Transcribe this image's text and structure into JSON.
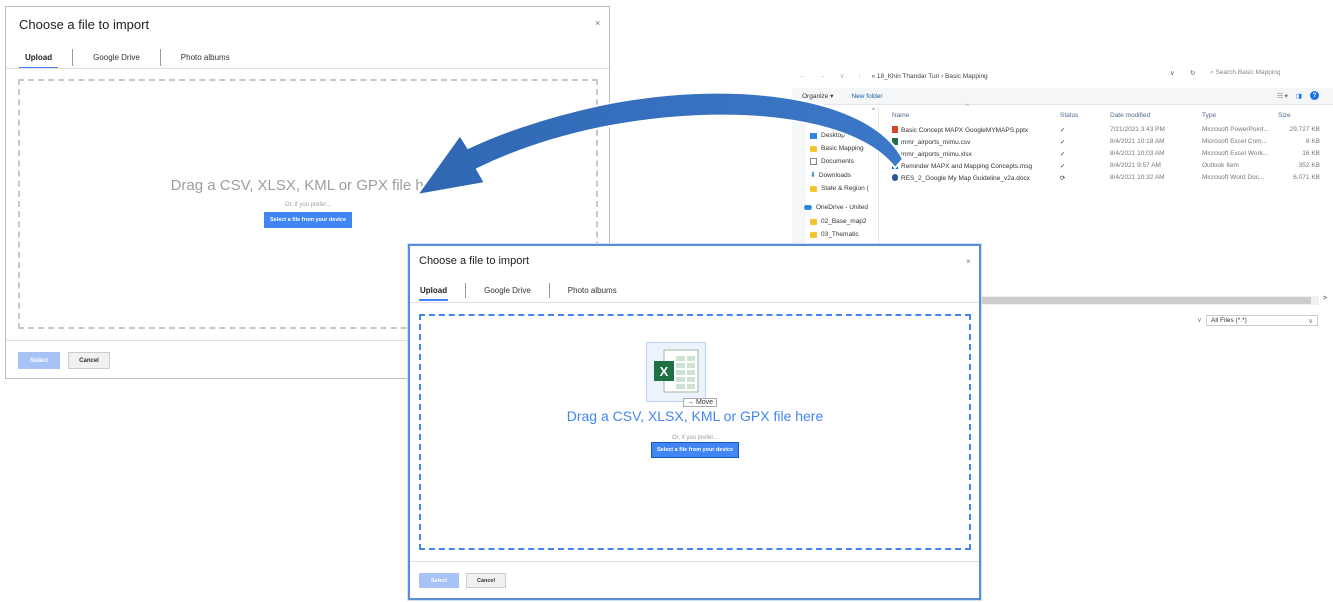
{
  "back_dialog": {
    "title": "Choose a file to import",
    "close": "×",
    "tabs": [
      "Upload",
      "Google Drive",
      "Photo albums"
    ],
    "drag_text": "Drag a CSV, XLSX, KML or GPX file here",
    "or_text": "Or, if you prefer...",
    "device_button": "Select a file from your device",
    "select_button": "Select",
    "cancel_button": "Cancel"
  },
  "explorer": {
    "nav_arrows": "← → ∨ ↑",
    "breadcrumb": "« 18_Khin Thandar Tun › Basic Mapping",
    "address_dropdown": "∨",
    "refresh": "↻",
    "search_placeholder": "⌕  Search Basic Mapping",
    "organize": "Organize ▾",
    "new_folder": "New folder",
    "view_icon": "☷ ▾",
    "pane_icon": "◨",
    "help": "?",
    "nav_scroll_up": "^",
    "nav_items": [
      {
        "label": "Desktop",
        "icon": "desktop-icon"
      },
      {
        "label": "Basic Mapping",
        "icon": "folder-icon"
      },
      {
        "label": "Documents",
        "icon": "documents-icon"
      },
      {
        "label": "Downloads",
        "icon": "downloads-icon"
      },
      {
        "label": "State & Region (",
        "icon": "folder-icon"
      },
      {
        "label": "OneDrive - United",
        "icon": "onedrive-icon"
      },
      {
        "label": "02_Base_map2",
        "icon": "folder-icon"
      },
      {
        "label": "03_Thematic",
        "icon": "folder-icon"
      }
    ],
    "columns": {
      "name": "Name",
      "status": "Status",
      "date": "Date modified",
      "type": "Type",
      "size": "Size",
      "sort": "^"
    },
    "files": [
      {
        "name": "Basic Concept MAPX GoogleMYMAPS.pptx",
        "kind": "pptx",
        "status": "✓",
        "date": "7/21/2021 3:43 PM",
        "type": "Microsoft PowerPoint...",
        "size": "29,727 KB"
      },
      {
        "name": "mmr_airports_mimu.csv",
        "kind": "csv",
        "status": "✓",
        "date": "8/4/2021 10:18 AM",
        "type": "Microsoft Excel Com...",
        "size": "8 KB"
      },
      {
        "name": "mmr_airports_mimu.xlsx",
        "kind": "xlsx",
        "status": "✓",
        "date": "8/4/2021 10:03 AM",
        "type": "Microsoft Excel Work...",
        "size": "16 KB"
      },
      {
        "name": "Reminder MAPX and Mapping Concepts.msg",
        "kind": "msg",
        "status": "✓",
        "date": "8/4/2021 9:57 AM",
        "type": "Outlook Item",
        "size": "352 KB"
      },
      {
        "name": "RES_2_Google My Map Guideline_v2a.docx",
        "kind": "docx",
        "status": "⟳",
        "date": "8/4/2021 10:32 AM",
        "type": "Microsoft Word Doc...",
        "size": "6,071 KB"
      }
    ],
    "hscroll_arrow": ">",
    "filetype_arrow": "∨",
    "filetype": "All Files (*.*)",
    "filetype_dropdown": "∨"
  },
  "front_dialog": {
    "title": "Choose a file to import",
    "close": "×",
    "tabs": [
      "Upload",
      "Google Drive",
      "Photo albums"
    ],
    "move_tooltip": "→ Move",
    "drag_text": "Drag a CSV, XLSX, KML or GPX file here",
    "or_text": "Or, if you prefer...",
    "device_button": "Select a file from your device",
    "select_button": "Select",
    "cancel_button": "Cancel"
  },
  "colors": {
    "accent": "#4285f4",
    "arrow": "#2f67b3",
    "select_disabled": "#a7c3f6"
  }
}
